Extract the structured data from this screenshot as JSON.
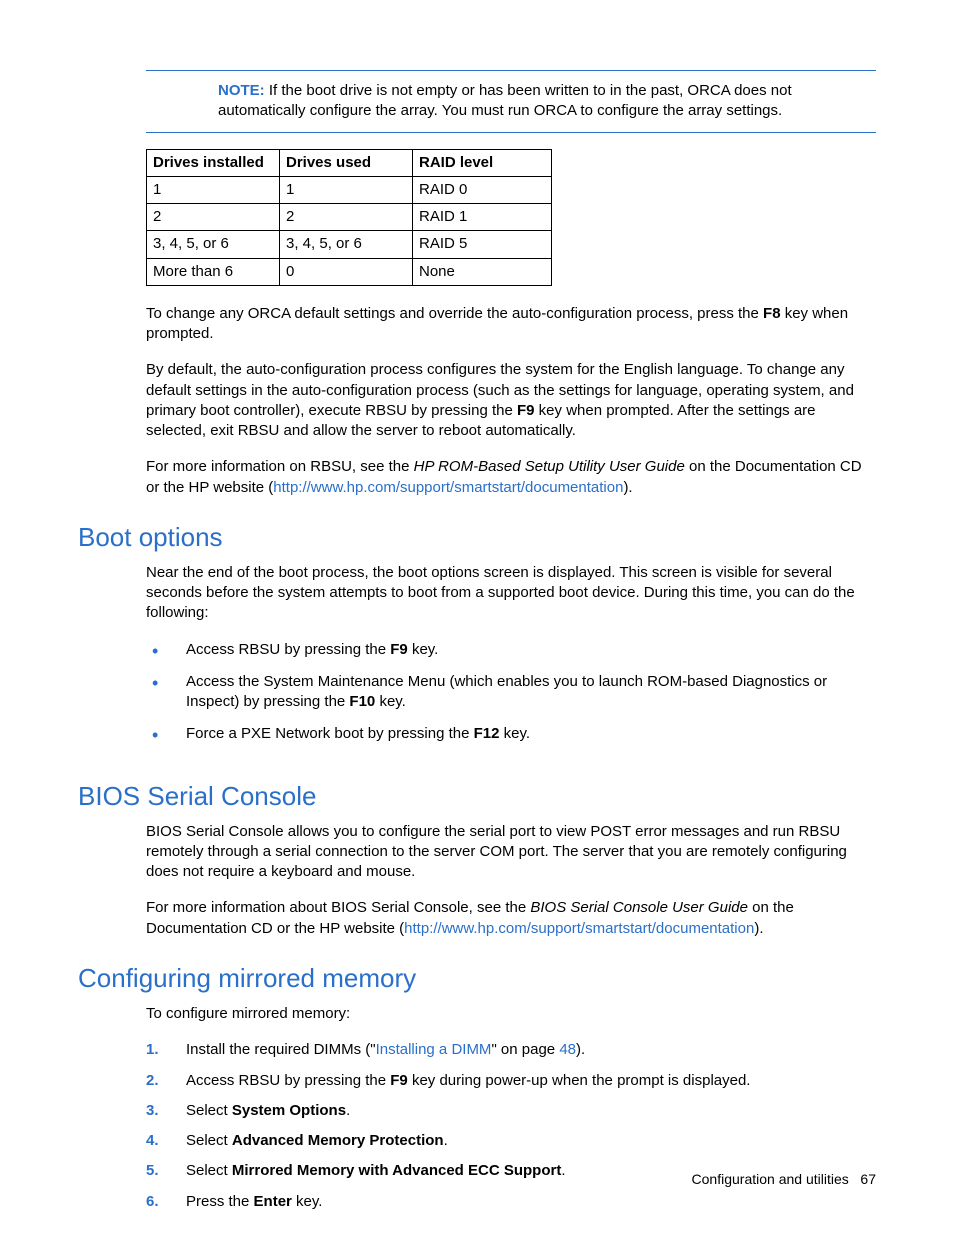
{
  "note": {
    "label": "NOTE:",
    "text": "If the boot drive is not empty or has been written to in the past, ORCA does not automatically configure the array. You must run ORCA to configure the array settings."
  },
  "table": {
    "headers": [
      "Drives installed",
      "Drives used",
      "RAID level"
    ],
    "rows": [
      [
        "1",
        "1",
        "RAID 0"
      ],
      [
        "2",
        "2",
        "RAID 1"
      ],
      [
        "3, 4, 5, or 6",
        "3, 4, 5, or 6",
        "RAID 5"
      ],
      [
        "More than 6",
        "0",
        "None"
      ]
    ]
  },
  "para1_a": "To change any ORCA default settings and override the auto-configuration process, press the ",
  "para1_key": "F8",
  "para1_b": " key when prompted.",
  "para2_a": "By default, the auto-configuration process configures the system for the English language. To change any default settings in the auto-configuration process (such as the settings for language, operating system, and primary boot controller), execute RBSU by pressing the ",
  "para2_key": "F9",
  "para2_b": " key when prompted. After the settings are selected, exit RBSU and allow the server to reboot automatically.",
  "para3_a": "For more information on RBSU, see the ",
  "para3_i": "HP ROM-Based Setup Utility User Guide",
  "para3_b": " on the Documentation CD or the HP website (",
  "para3_link": "http://www.hp.com/support/smartstart/documentation",
  "para3_c": ").",
  "sec_boot": {
    "title": "Boot options",
    "intro": "Near the end of the boot process, the boot options screen is displayed. This screen is visible for several seconds before the system attempts to boot from a supported boot device. During this time, you can do the following:",
    "b1_a": "Access RBSU by pressing the ",
    "b1_key": "F9",
    "b1_b": " key.",
    "b2_a": "Access the System Maintenance Menu (which enables you to launch ROM-based Diagnostics or Inspect) by pressing the ",
    "b2_key": "F10",
    "b2_b": " key.",
    "b3_a": "Force a PXE Network boot by pressing the ",
    "b3_key": "F12",
    "b3_b": " key."
  },
  "sec_bios": {
    "title": "BIOS Serial Console",
    "p1": "BIOS Serial Console allows you to configure the serial port to view POST error messages and run RBSU remotely through a serial connection to the server COM port. The server that you are remotely configuring does not require a keyboard and mouse.",
    "p2_a": "For more information about BIOS Serial Console, see the ",
    "p2_i": "BIOS Serial Console User Guide",
    "p2_b": " on the Documentation CD or the HP website (",
    "p2_link": "http://www.hp.com/support/smartstart/documentation",
    "p2_c": ")."
  },
  "sec_mem": {
    "title": "Configuring mirrored memory",
    "intro": "To configure mirrored memory:",
    "s1_a": "Install the required DIMMs (\"",
    "s1_link": "Installing a DIMM",
    "s1_b": "\" on page ",
    "s1_page": "48",
    "s1_c": ").",
    "s2_a": "Access RBSU by pressing the ",
    "s2_key": "F9",
    "s2_b": " key during power-up when the prompt is displayed.",
    "s3_a": "Select ",
    "s3_bold": "System Options",
    "s3_b": ".",
    "s4_a": "Select ",
    "s4_bold": "Advanced Memory Protection",
    "s4_b": ".",
    "s5_a": "Select ",
    "s5_bold": "Mirrored Memory with Advanced ECC Support",
    "s5_b": ".",
    "s6_a": "Press the ",
    "s6_bold": "Enter",
    "s6_b": " key."
  },
  "footer": {
    "section": "Configuration and utilities",
    "page": "67"
  }
}
